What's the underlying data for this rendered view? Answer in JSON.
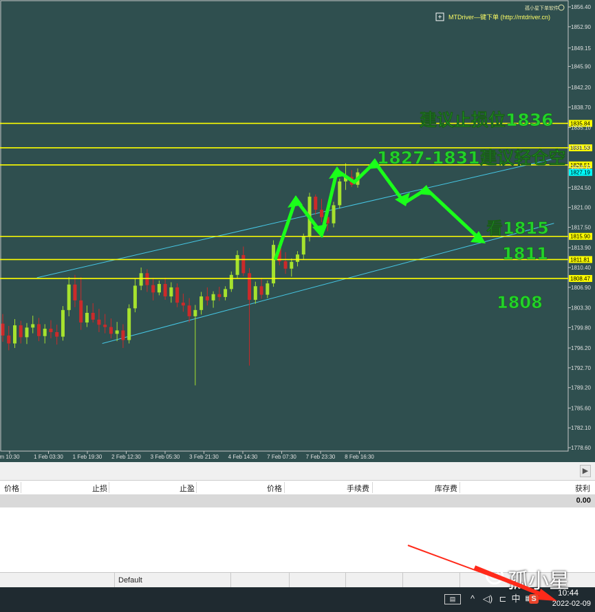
{
  "header": {
    "brand_small": "孤小星下单软件",
    "plugin_label": "MTDriver—键下单 (http://mtdriver.cn)"
  },
  "chart_data": {
    "type": "candlestick",
    "y_ticks": [
      1856.4,
      1852.9,
      1849.15,
      1845.9,
      1842.2,
      1838.7,
      1835.1,
      1831.6,
      1828.1,
      1824.5,
      1821.0,
      1817.5,
      1813.9,
      1810.4,
      1806.9,
      1803.3,
      1799.8,
      1796.2,
      1792.7,
      1789.2,
      1785.6,
      1782.1,
      1778.6
    ],
    "ylim": [
      1778.0,
      1857.5
    ],
    "x_tick_labels": [
      "m 10:30",
      "1 Feb 03:30",
      "1 Feb 19:30",
      "2 Feb 12:30",
      "3 Feb 05:30",
      "3 Feb 21:30",
      "4 Feb 14:30",
      "7 Feb 07:30",
      "7 Feb 23:30",
      "8 Feb 16:30"
    ],
    "price_levels": [
      {
        "value": 1835.84,
        "label": "1835.84"
      },
      {
        "value": 1831.53,
        "label": "1831.53"
      },
      {
        "value": 1828.51,
        "label": "1828.51"
      },
      {
        "value": 1815.9,
        "label": "1815.90"
      },
      {
        "value": 1811.81,
        "label": "1811.81"
      },
      {
        "value": 1808.47,
        "label": "1808.47"
      }
    ],
    "current_price": {
      "value": 1827.19,
      "label": "1827.19"
    },
    "annotations": {
      "stop_loss": "建议止损位1836",
      "short_zone": "1827-1831建议轻仓空",
      "target_1815": "看1815",
      "level_1811": "1811",
      "level_1808": "1808"
    },
    "candles": [
      [
        1800.5,
        1802.2,
        1797.3,
        1798.4
      ],
      [
        1798.4,
        1800.1,
        1795.8,
        1797.0
      ],
      [
        1797.0,
        1801.3,
        1796.2,
        1800.2
      ],
      [
        1800.2,
        1801.0,
        1797.0,
        1798.1
      ],
      [
        1798.1,
        1800.6,
        1796.9,
        1799.8
      ],
      [
        1799.8,
        1801.9,
        1798.8,
        1800.4
      ],
      [
        1800.4,
        1801.5,
        1797.4,
        1798.3
      ],
      [
        1798.3,
        1800.4,
        1797.0,
        1799.6
      ],
      [
        1799.6,
        1801.1,
        1797.9,
        1799.0
      ],
      [
        1799.0,
        1800.3,
        1796.8,
        1798.2
      ],
      [
        1798.2,
        1803.6,
        1797.5,
        1802.9
      ],
      [
        1802.9,
        1808.7,
        1801.8,
        1807.4
      ],
      [
        1807.4,
        1809.1,
        1803.4,
        1804.6
      ],
      [
        1804.6,
        1808.7,
        1799.4,
        1800.7
      ],
      [
        1800.7,
        1803.7,
        1799.9,
        1802.4
      ],
      [
        1802.4,
        1804.1,
        1800.7,
        1801.2
      ],
      [
        1801.2,
        1803.1,
        1799.0,
        1800.3
      ],
      [
        1800.3,
        1802.2,
        1798.8,
        1799.9
      ],
      [
        1799.9,
        1801.4,
        1797.9,
        1798.7
      ],
      [
        1798.7,
        1800.8,
        1797.4,
        1799.3
      ],
      [
        1799.3,
        1800.4,
        1796.2,
        1797.6
      ],
      [
        1797.6,
        1803.9,
        1797.0,
        1803.2
      ],
      [
        1803.2,
        1808.5,
        1802.5,
        1807.2
      ],
      [
        1807.2,
        1810.4,
        1806.4,
        1809.4
      ],
      [
        1809.4,
        1810.1,
        1806.1,
        1807.3
      ],
      [
        1807.3,
        1808.6,
        1804.6,
        1806.0
      ],
      [
        1806.0,
        1808.1,
        1805.5,
        1807.5
      ],
      [
        1807.5,
        1808.6,
        1804.7,
        1805.3
      ],
      [
        1805.3,
        1807.8,
        1804.2,
        1806.9
      ],
      [
        1806.9,
        1807.6,
        1803.4,
        1804.2
      ],
      [
        1804.2,
        1805.8,
        1802.6,
        1803.7
      ],
      [
        1803.7,
        1805.0,
        1800.7,
        1801.8
      ],
      [
        1801.8,
        1803.8,
        1789.6,
        1802.9
      ],
      [
        1802.9,
        1806.1,
        1802.1,
        1805.3
      ],
      [
        1805.3,
        1806.9,
        1803.7,
        1804.6
      ],
      [
        1804.6,
        1806.2,
        1803.3,
        1805.7
      ],
      [
        1805.7,
        1807.0,
        1804.5,
        1805.2
      ],
      [
        1805.2,
        1807.1,
        1804.6,
        1806.6
      ],
      [
        1806.6,
        1809.7,
        1806.1,
        1809.1
      ],
      [
        1809.1,
        1813.4,
        1808.4,
        1812.6
      ],
      [
        1812.6,
        1814.1,
        1808.9,
        1809.4
      ],
      [
        1809.4,
        1810.3,
        1793.1,
        1804.7
      ],
      [
        1804.7,
        1807.9,
        1804.0,
        1807.1
      ],
      [
        1807.1,
        1808.6,
        1804.9,
        1805.6
      ],
      [
        1805.6,
        1808.1,
        1805.0,
        1807.6
      ],
      [
        1807.6,
        1815.2,
        1807.0,
        1814.4
      ],
      [
        1814.4,
        1815.0,
        1810.8,
        1811.5
      ],
      [
        1811.5,
        1813.1,
        1809.3,
        1810.2
      ],
      [
        1810.2,
        1812.0,
        1808.8,
        1811.4
      ],
      [
        1811.4,
        1813.3,
        1810.6,
        1812.7
      ],
      [
        1812.7,
        1816.4,
        1811.9,
        1815.8
      ],
      [
        1815.8,
        1823.6,
        1815.0,
        1822.9
      ],
      [
        1822.9,
        1823.3,
        1819.7,
        1820.6
      ],
      [
        1820.6,
        1822.5,
        1818.4,
        1819.3
      ],
      [
        1819.3,
        1821.2,
        1816.8,
        1818.2
      ],
      [
        1818.2,
        1822.0,
        1817.5,
        1821.4
      ],
      [
        1821.4,
        1826.1,
        1820.8,
        1825.6
      ],
      [
        1825.6,
        1828.8,
        1824.1,
        1826.4
      ],
      [
        1826.4,
        1827.6,
        1824.6,
        1825.0
      ],
      [
        1825.0,
        1827.9,
        1824.5,
        1827.2
      ]
    ],
    "trendlines": [
      {
        "x0": 0.065,
        "v0": 1808.6,
        "x1": 0.975,
        "v1": 1829.6
      },
      {
        "x0": 0.18,
        "v0": 1797.0,
        "x1": 0.975,
        "v1": 1818.2
      }
    ]
  },
  "terminal": {
    "columns": [
      "价格",
      "止损",
      "止盈",
      "价格",
      "手续费",
      "库存费",
      "获利"
    ],
    "total_profit": "0.00"
  },
  "statusbar": {
    "profile": "Default"
  },
  "taskbar": {
    "tray_icons": [
      "keyboard-icon",
      "chevron-up-icon",
      "speaker-icon",
      "network-icon",
      "ime-zh",
      "grid-icon",
      "sogou-icon"
    ],
    "ime_label": "中",
    "sogou_label": "S",
    "time": "10:44",
    "date": "2022-02-09"
  },
  "watermark": "孤小星",
  "colors": {
    "chart_bg": "#2f4f4f",
    "bull": "#a6e22e",
    "bear": "#cc2a2a",
    "level_line": "#ffff00",
    "level_text": "#22d22a",
    "trendline": "#46c8e6",
    "arrow": "#1aff1a",
    "price_tag": "#00ffff"
  }
}
